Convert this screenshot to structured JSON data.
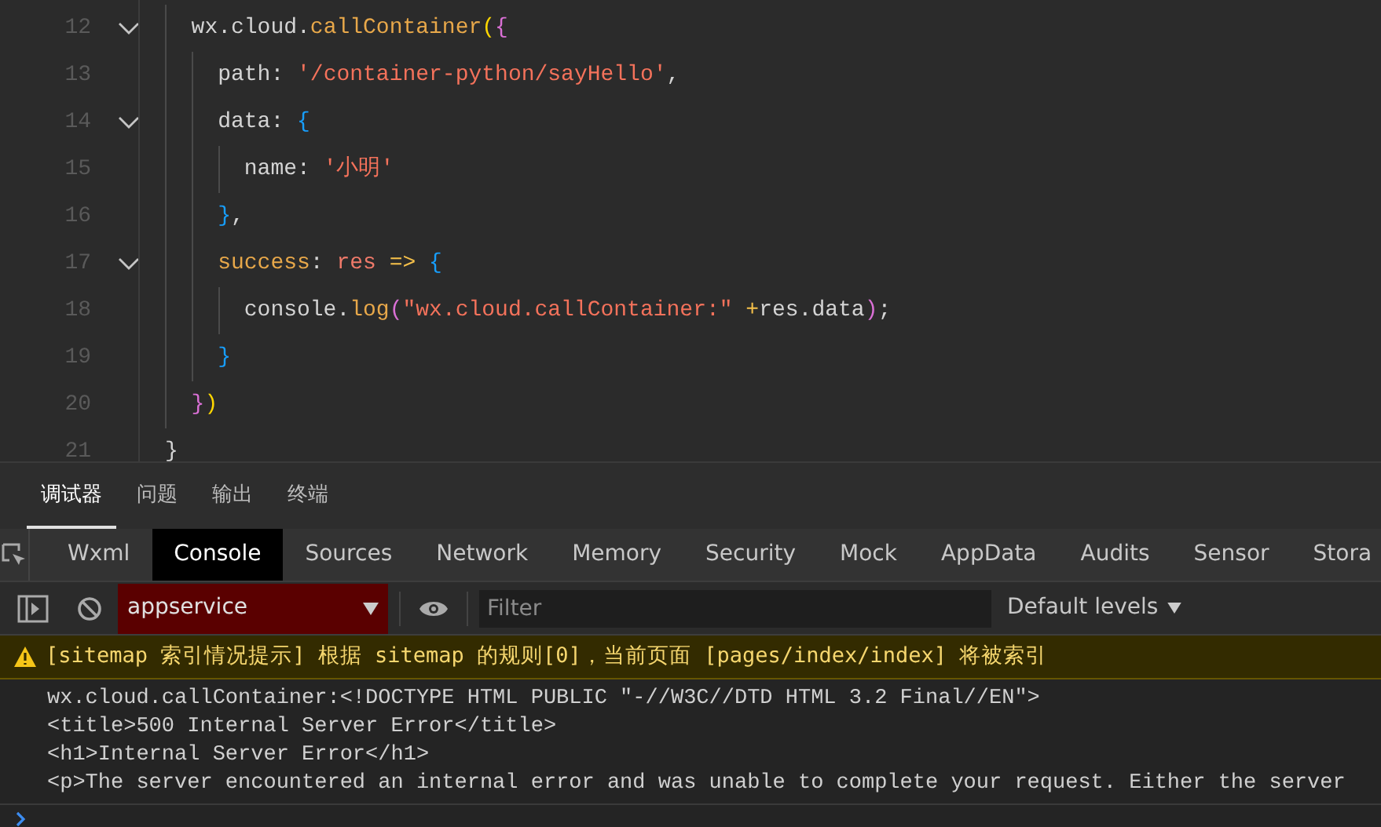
{
  "code_lines": [
    {
      "number": "12",
      "fold": true,
      "tokens": [
        {
          "text": "  wx.cloud.",
          "kind": "plain"
        },
        {
          "text": "callContainer",
          "kind": "function"
        },
        {
          "text": "(",
          "kind": "bracket_gold"
        },
        {
          "text": "{",
          "kind": "bracket_orchid"
        }
      ]
    },
    {
      "number": "13",
      "fold": false,
      "tokens": [
        {
          "text": "    path: ",
          "kind": "plain"
        },
        {
          "text": "'/container-python/sayHello'",
          "kind": "string"
        },
        {
          "text": ",",
          "kind": "plain"
        }
      ]
    },
    {
      "number": "14",
      "fold": true,
      "tokens": [
        {
          "text": "    data: ",
          "kind": "plain"
        },
        {
          "text": "{",
          "kind": "bracket_blue"
        }
      ]
    },
    {
      "number": "15",
      "fold": false,
      "tokens": [
        {
          "text": "      name: ",
          "kind": "plain"
        },
        {
          "text": "'小明'",
          "kind": "string"
        }
      ]
    },
    {
      "number": "16",
      "fold": false,
      "tokens": [
        {
          "text": "    }",
          "kind": "bracket_blue"
        },
        {
          "text": ",",
          "kind": "plain"
        }
      ]
    },
    {
      "number": "17",
      "fold": true,
      "tokens": [
        {
          "text": "    success",
          "kind": "function"
        },
        {
          "text": ": ",
          "kind": "plain"
        },
        {
          "text": "res",
          "kind": "parameter"
        },
        {
          "text": " => ",
          "kind": "operator"
        },
        {
          "text": "{",
          "kind": "bracket_blue"
        }
      ]
    },
    {
      "number": "18",
      "fold": false,
      "tokens": [
        {
          "text": "      console.",
          "kind": "plain"
        },
        {
          "text": "log",
          "kind": "function"
        },
        {
          "text": "(",
          "kind": "bracket_orchid"
        },
        {
          "text": "\"wx.cloud.callContainer:\"",
          "kind": "string"
        },
        {
          "text": " +",
          "kind": "operator"
        },
        {
          "text": "res.data",
          "kind": "plain"
        },
        {
          "text": ")",
          "kind": "bracket_orchid"
        },
        {
          "text": ";",
          "kind": "plain"
        }
      ]
    },
    {
      "number": "19",
      "fold": false,
      "tokens": [
        {
          "text": "    }",
          "kind": "bracket_blue"
        }
      ]
    },
    {
      "number": "20",
      "fold": false,
      "tokens": [
        {
          "text": "  }",
          "kind": "bracket_orchid"
        },
        {
          "text": ")",
          "kind": "bracket_gold"
        }
      ]
    },
    {
      "number": "21",
      "fold": false,
      "tokens": [
        {
          "text": "}",
          "kind": "plain"
        }
      ]
    }
  ],
  "panel_tabs": [
    {
      "label": "调试器",
      "selected": true
    },
    {
      "label": "问题",
      "selected": false
    },
    {
      "label": "输出",
      "selected": false
    },
    {
      "label": "终端",
      "selected": false
    }
  ],
  "devtools_tabs": [
    {
      "label": "Wxml",
      "selected": false
    },
    {
      "label": "Console",
      "selected": true
    },
    {
      "label": "Sources",
      "selected": false
    },
    {
      "label": "Network",
      "selected": false
    },
    {
      "label": "Memory",
      "selected": false
    },
    {
      "label": "Security",
      "selected": false
    },
    {
      "label": "Mock",
      "selected": false
    },
    {
      "label": "AppData",
      "selected": false
    },
    {
      "label": "Audits",
      "selected": false
    },
    {
      "label": "Sensor",
      "selected": false
    },
    {
      "label": "Stora",
      "selected": false
    }
  ],
  "toolbar": {
    "context": "appservice",
    "filter_placeholder": "Filter",
    "levels": "Default levels"
  },
  "console": {
    "warning": "[sitemap 索引情况提示] 根据 sitemap 的规则[0]，当前页面 [pages/index/index] 将被索引",
    "log_lines": [
      "wx.cloud.callContainer:<!DOCTYPE HTML PUBLIC \"-//W3C//DTD HTML 3.2 Final//EN\">",
      "<title>500 Internal Server Error</title>",
      "<h1>Internal Server Error</h1>",
      "<p>The server encountered an internal error and was unable to complete your request. Either the server"
    ]
  }
}
